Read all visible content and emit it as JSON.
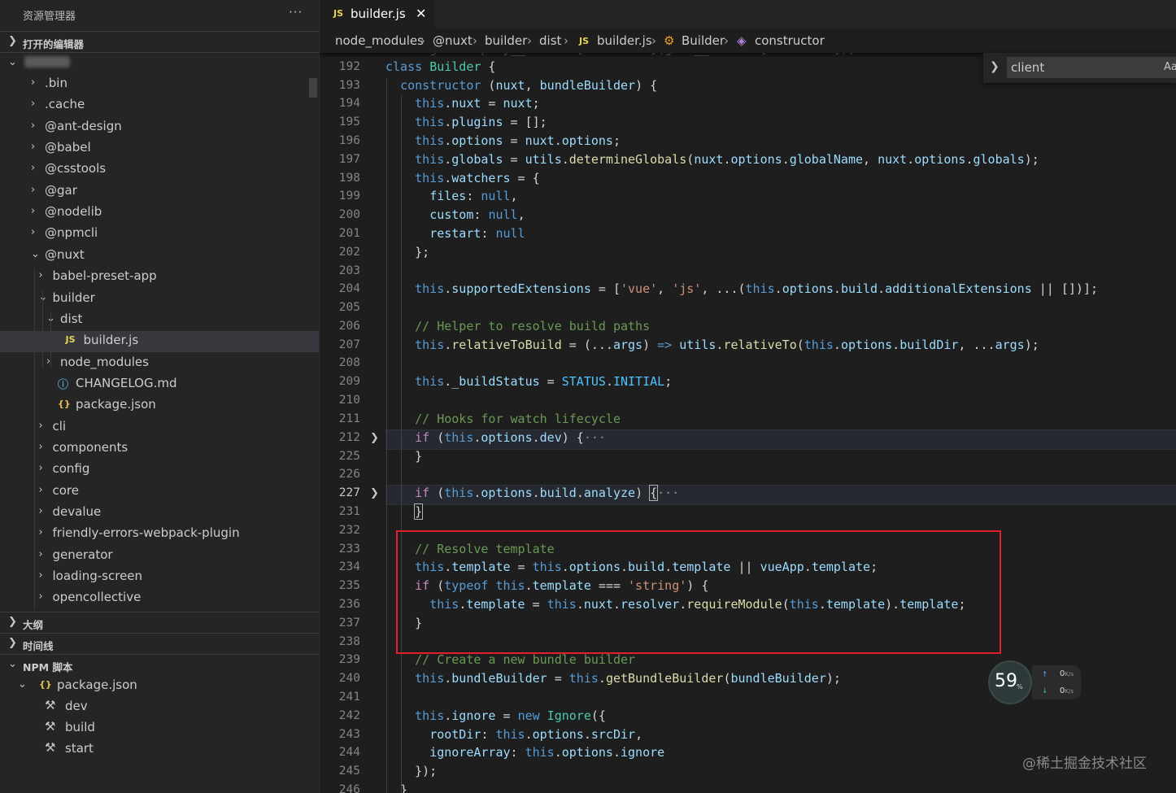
{
  "sidebar": {
    "title": "资源管理器",
    "more": "···",
    "open_editors": "打开的编辑器",
    "tree": [
      {
        "label": ".bin",
        "chevron": "›",
        "icon": ""
      },
      {
        "label": ".cache",
        "chevron": "›",
        "icon": ""
      },
      {
        "label": "@ant-design",
        "chevron": "›",
        "icon": ""
      },
      {
        "label": "@babel",
        "chevron": "›",
        "icon": ""
      },
      {
        "label": "@csstools",
        "chevron": "›",
        "icon": ""
      },
      {
        "label": "@gar",
        "chevron": "›",
        "icon": ""
      },
      {
        "label": "@nodelib",
        "chevron": "›",
        "icon": ""
      },
      {
        "label": "@npmcli",
        "chevron": "›",
        "icon": ""
      },
      {
        "label": "@nuxt",
        "chevron": "⌄",
        "icon": ""
      },
      {
        "label": "babel-preset-app",
        "chevron": "›",
        "icon": ""
      },
      {
        "label": "builder",
        "chevron": "⌄",
        "icon": ""
      },
      {
        "label": "dist",
        "chevron": "⌄",
        "icon": ""
      },
      {
        "label": "builder.js",
        "chevron": "",
        "icon": "JS"
      },
      {
        "label": "node_modules",
        "chevron": "›",
        "icon": ""
      },
      {
        "label": "CHANGELOG.md",
        "chevron": "",
        "icon": "ⓘ"
      },
      {
        "label": "package.json",
        "chevron": "",
        "icon": "{}"
      },
      {
        "label": "cli",
        "chevron": "›",
        "icon": ""
      },
      {
        "label": "components",
        "chevron": "›",
        "icon": ""
      },
      {
        "label": "config",
        "chevron": "›",
        "icon": ""
      },
      {
        "label": "core",
        "chevron": "›",
        "icon": ""
      },
      {
        "label": "devalue",
        "chevron": "›",
        "icon": ""
      },
      {
        "label": "friendly-errors-webpack-plugin",
        "chevron": "›",
        "icon": ""
      },
      {
        "label": "generator",
        "chevron": "›",
        "icon": ""
      },
      {
        "label": "loading-screen",
        "chevron": "›",
        "icon": ""
      },
      {
        "label": "opencollective",
        "chevron": "›",
        "icon": ""
      }
    ],
    "outline": "大纲",
    "timeline": "时间线",
    "npm_scripts": "NPM 脚本",
    "npm_package": "package.json",
    "npm_items": [
      "dev",
      "build",
      "start"
    ]
  },
  "tab": {
    "icon": "JS",
    "name": "builder.js",
    "close": "✕"
  },
  "breadcrumb": {
    "items": [
      "node_modules",
      "@nuxt",
      "builder",
      "dist",
      "builder.js",
      "Builder",
      "constructor"
    ],
    "separator": "›",
    "js_icon": "JS"
  },
  "find": {
    "value": "client",
    "case_toggle": "Aa"
  },
  "editor": {
    "line_numbers": [
      "192",
      "193",
      "194",
      "195",
      "196",
      "197",
      "198",
      "199",
      "200",
      "201",
      "202",
      "203",
      "204",
      "205",
      "206",
      "207",
      "208",
      "209",
      "210",
      "211",
      "212",
      "225",
      "226",
      "227",
      "231",
      "232",
      "233",
      "234",
      "235",
      "236",
      "237",
      "238",
      "239",
      "240",
      "241",
      "242",
      "243",
      "244",
      "245",
      "246"
    ],
    "current_line": "227",
    "folded_lines": [
      "212",
      "227"
    ]
  },
  "netmeter": {
    "percent": "59",
    "percent_sign": "%",
    "up": "0",
    "down": "0",
    "unit": "K/s"
  },
  "watermark": "@稀土掘金技术社区",
  "colors": {
    "highlight_box": "#e0202a",
    "keyword": "#569cd6",
    "control": "#c586c0",
    "variable": "#9cdcfe",
    "function": "#dcdcaa",
    "string": "#ce9178",
    "comment": "#6a9955"
  }
}
